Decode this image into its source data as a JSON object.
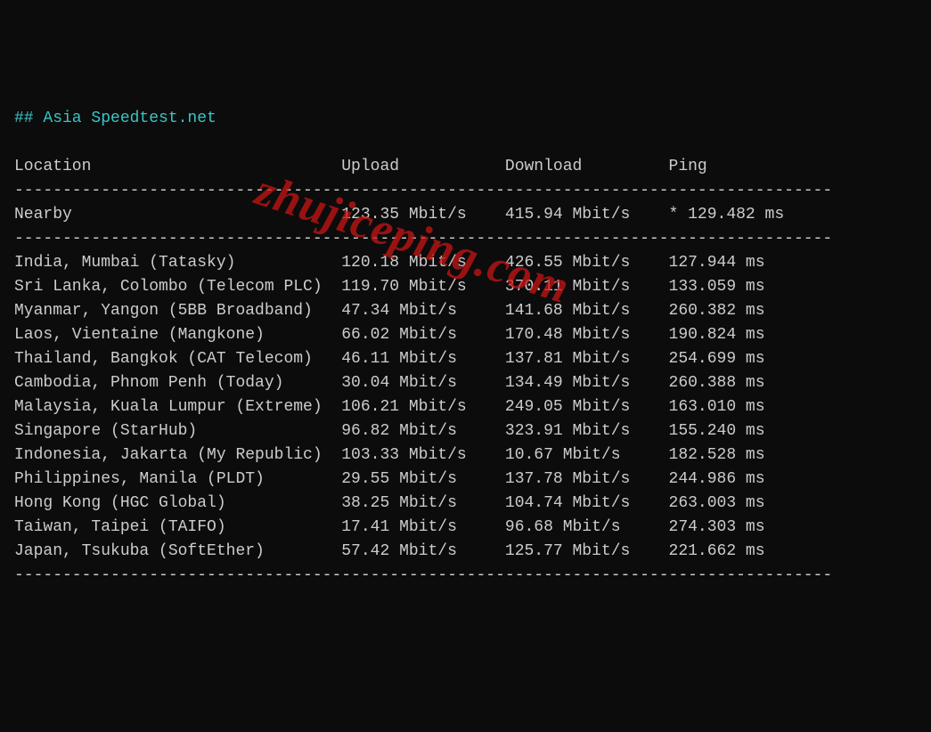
{
  "title": "## Asia Speedtest.net",
  "headers": {
    "location": "Location",
    "upload": "Upload",
    "download": "Download",
    "ping": "Ping"
  },
  "nearby": {
    "label": "Nearby",
    "upload": "123.35 Mbit/s",
    "download": "415.94 Mbit/s",
    "ping": "* 129.482 ms"
  },
  "rows": [
    {
      "location": "India, Mumbai (Tatasky)",
      "upload": "120.18 Mbit/s",
      "download": "426.55 Mbit/s",
      "ping": "127.944 ms"
    },
    {
      "location": "Sri Lanka, Colombo (Telecom PLC)",
      "upload": "119.70 Mbit/s",
      "download": "370.11 Mbit/s",
      "ping": "133.059 ms"
    },
    {
      "location": "Myanmar, Yangon (5BB Broadband)",
      "upload": "47.34 Mbit/s",
      "download": "141.68 Mbit/s",
      "ping": "260.382 ms"
    },
    {
      "location": "Laos, Vientaine (Mangkone)",
      "upload": "66.02 Mbit/s",
      "download": "170.48 Mbit/s",
      "ping": "190.824 ms"
    },
    {
      "location": "Thailand, Bangkok (CAT Telecom)",
      "upload": "46.11 Mbit/s",
      "download": "137.81 Mbit/s",
      "ping": "254.699 ms"
    },
    {
      "location": "Cambodia, Phnom Penh (Today)",
      "upload": "30.04 Mbit/s",
      "download": "134.49 Mbit/s",
      "ping": "260.388 ms"
    },
    {
      "location": "Malaysia, Kuala Lumpur (Extreme)",
      "upload": "106.21 Mbit/s",
      "download": "249.05 Mbit/s",
      "ping": "163.010 ms"
    },
    {
      "location": "Singapore (StarHub)",
      "upload": "96.82 Mbit/s",
      "download": "323.91 Mbit/s",
      "ping": "155.240 ms"
    },
    {
      "location": "Indonesia, Jakarta (My Republic)",
      "upload": "103.33 Mbit/s",
      "download": "10.67 Mbit/s",
      "ping": "182.528 ms"
    },
    {
      "location": "Philippines, Manila (PLDT)",
      "upload": "29.55 Mbit/s",
      "download": "137.78 Mbit/s",
      "ping": "244.986 ms"
    },
    {
      "location": "Hong Kong (HGC Global)",
      "upload": "38.25 Mbit/s",
      "download": "104.74 Mbit/s",
      "ping": "263.003 ms"
    },
    {
      "location": "Taiwan, Taipei (TAIFO)",
      "upload": "17.41 Mbit/s",
      "download": "96.68 Mbit/s",
      "ping": "274.303 ms"
    },
    {
      "location": "Japan, Tsukuba (SoftEther)",
      "upload": "57.42 Mbit/s",
      "download": "125.77 Mbit/s",
      "ping": "221.662 ms"
    }
  ],
  "watermark": "zhujiceping.com",
  "layout": {
    "col1": 0,
    "col2": 34,
    "col3": 51,
    "col4": 68,
    "sepLen": 85
  }
}
